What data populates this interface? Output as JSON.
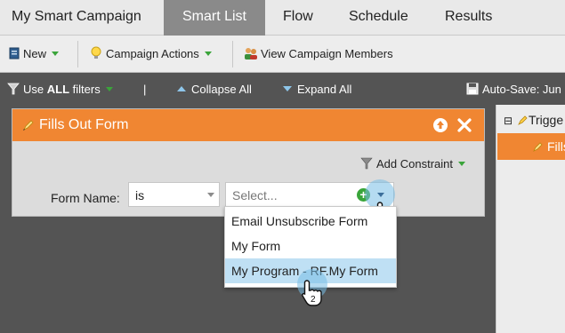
{
  "tabs": [
    {
      "label": "My Smart Campaign",
      "active": false
    },
    {
      "label": "Smart List",
      "active": true
    },
    {
      "label": "Flow",
      "active": false
    },
    {
      "label": "Schedule",
      "active": false
    },
    {
      "label": "Results",
      "active": false
    }
  ],
  "toolbar": {
    "new_label": "New",
    "campaign_actions_label": "Campaign Actions",
    "view_members_label": "View Campaign Members"
  },
  "filterbar": {
    "use_label": "Use",
    "all_label": "ALL",
    "filters_label": "filters",
    "separator": "|",
    "collapse_label": "Collapse All",
    "expand_label": "Expand All",
    "autosave_label": "Auto-Save: Jun"
  },
  "card": {
    "title": "Fills Out Form",
    "add_constraint_label": "Add Constraint",
    "form_name_label": "Form Name:",
    "operator_value": "is",
    "select_placeholder": "Select..."
  },
  "dropdown": {
    "options": [
      {
        "label": "Email Unsubscribe Form",
        "hovered": false
      },
      {
        "label": "My Form",
        "hovered": false
      },
      {
        "label": "My Program - RF.My Form",
        "hovered": true
      }
    ]
  },
  "steps": {
    "step1": "1",
    "step2": "2"
  },
  "right_panel": {
    "tree_toggle": "⊟",
    "trigger_label": "Trigge",
    "fills_label": "Fills"
  },
  "colors": {
    "accent_orange": "#f08632",
    "add_green": "#39a53a",
    "hover_blue": "#bfe0f4",
    "highlight_blue": "#78bee6",
    "canvas_dark": "#545454"
  },
  "icons": {
    "new": "document-icon",
    "campaign_actions": "lightbulb-icon",
    "view_members": "people-icon",
    "use_filters": "funnel-icon",
    "collapse": "chevron-up-icon",
    "expand": "chevron-down-icon",
    "autosave": "floppy-disk-icon",
    "card_title": "pencil-icon",
    "card_move_up": "arrow-up-circle-icon",
    "card_close": "close-icon",
    "add_constraint": "funnel-icon",
    "select_add": "plus-circle-icon",
    "cursor": "hand-pointer-icon"
  }
}
